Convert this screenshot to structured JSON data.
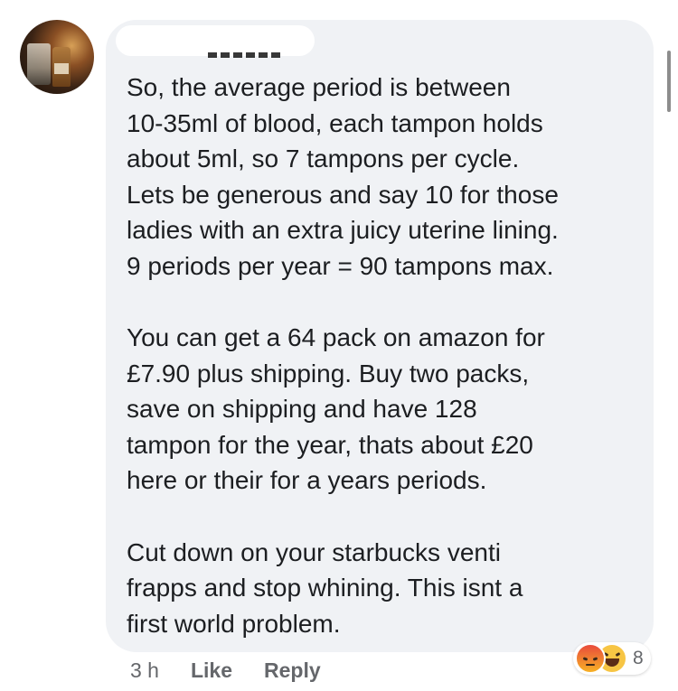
{
  "comment": {
    "paragraphs": [
      "So, the average period is between\n10-35ml of blood, each tampon holds\nabout 5ml, so 7 tampons per cycle.\nLets be generous and say 10 for those\nladies with an extra juicy uterine lining.\n9 periods per year = 90 tampons max.",
      "You can get a 64 pack on amazon for\n£7.90 plus shipping. Buy two packs,\nsave on shipping and have 128\ntampon for the year, thats about £20\nhere or their for a years periods.",
      "Cut down on your starbucks venti\nfrapps and stop whining. This isnt a\nfirst world problem."
    ]
  },
  "actions": {
    "time": "3 h",
    "like": "Like",
    "reply": "Reply"
  },
  "reactions": {
    "icons": [
      "angry-icon",
      "haha-icon"
    ],
    "count": "8"
  },
  "colors": {
    "bubble": "#f0f2f5",
    "text": "#1c1e21",
    "meta": "#65676b"
  }
}
